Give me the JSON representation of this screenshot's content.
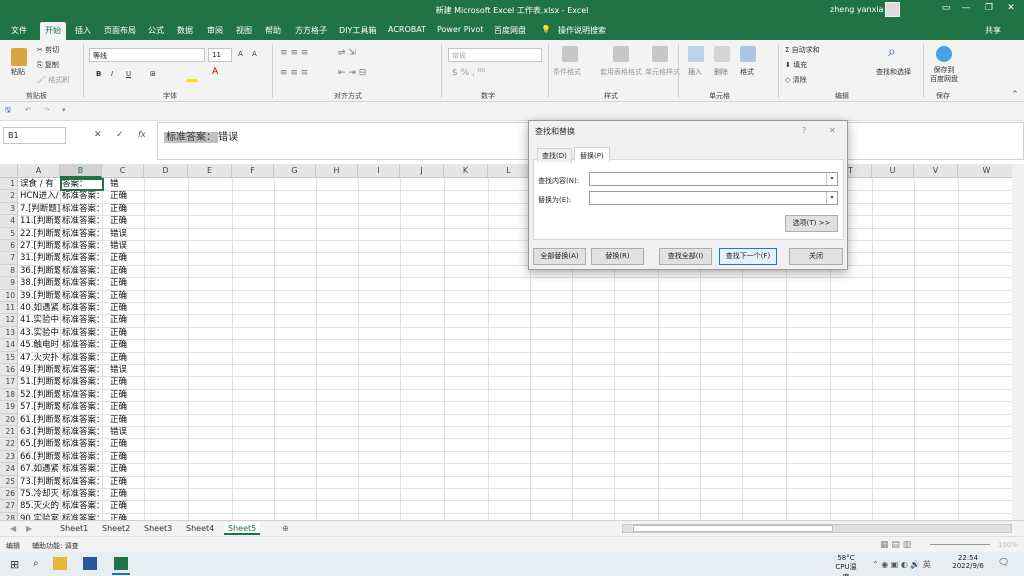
{
  "window": {
    "title": "新建 Microsoft Excel 工作表.xlsx  -  Excel",
    "user": "zheng yanxia",
    "controls": [
      "?",
      "—",
      "❐",
      "✕"
    ]
  },
  "ribbon_tabs": [
    "文件",
    "开始",
    "插入",
    "页面布局",
    "公式",
    "数据",
    "审阅",
    "视图",
    "帮助",
    "方方格子",
    "DIY工具箱",
    "ACROBAT",
    "Power Pivot",
    "百度网盘",
    "操作说明搜索"
  ],
  "share": "共享",
  "ribbon": {
    "clipboard": {
      "paste": "粘贴",
      "cut": "剪切",
      "copy": "复制",
      "format_painter": "格式刷",
      "label": "剪贴板"
    },
    "font": {
      "name": "等线",
      "size": "11",
      "bold": "B",
      "italic": "I",
      "underline": "U",
      "label": "字体"
    },
    "align": {
      "label": "对齐方式"
    },
    "number": {
      "format": "常规",
      "label": "数字"
    },
    "styles": {
      "conditional": "条件格式",
      "table": "套用表格格式",
      "cell_styles": "单元格样式",
      "label": "样式"
    },
    "cells": {
      "insert": "插入",
      "delete": "删除",
      "format": "格式",
      "label": "单元格"
    },
    "editing": {
      "autosum": "自动求和",
      "fill": "填充",
      "clear": "清除",
      "find": "查找和选择",
      "label": "编辑"
    },
    "save": {
      "btn": "保存到\n百度网盘",
      "label": "保存"
    }
  },
  "name_box": "B1",
  "fx": "fx",
  "formula": {
    "selected": "标准答案：",
    "rest": "错误"
  },
  "columns": [
    "A",
    "B",
    "C",
    "D",
    "E",
    "F",
    "G",
    "H",
    "I",
    "J",
    "K",
    "L",
    "M",
    "N",
    "O",
    "P",
    "Q",
    "R",
    "S",
    "T",
    "U",
    "V",
    "W"
  ],
  "rows": [
    {
      "n": "1",
      "a": "误食 / 有",
      "b": "答案：",
      "c": "错"
    },
    {
      "n": "2",
      "a": "HCN进入/",
      "b": "标准答案：",
      "c": "正确"
    },
    {
      "n": "3",
      "a": "7.[判断题]",
      "b": "标准答案：",
      "c": "正确"
    },
    {
      "n": "4",
      "a": "11.[判断题]",
      "b": "标准答案：",
      "c": "正确"
    },
    {
      "n": "5",
      "a": "22.[判断题]",
      "b": "标准答案：",
      "c": "错误"
    },
    {
      "n": "6",
      "a": "27.[判断题]",
      "b": "标准答案：",
      "c": "错误"
    },
    {
      "n": "7",
      "a": "31.[判断题]",
      "b": "标准答案：",
      "c": "正确"
    },
    {
      "n": "8",
      "a": "36.[判断题]",
      "b": "标准答案：",
      "c": "正确"
    },
    {
      "n": "9",
      "a": "38.[判断题]",
      "b": "标准答案：",
      "c": "正确"
    },
    {
      "n": "10",
      "a": "39.[判断题]",
      "b": "标准答案：",
      "c": "正确"
    },
    {
      "n": "11",
      "a": "40.如遇紧",
      "b": "标准答案：",
      "c": "正确"
    },
    {
      "n": "12",
      "a": "41.实验中",
      "b": "标准答案：",
      "c": "正确"
    },
    {
      "n": "13",
      "a": "43.实验中",
      "b": "标准答案：",
      "c": "正确"
    },
    {
      "n": "14",
      "a": "45.触电时",
      "b": "标准答案：",
      "c": "正确"
    },
    {
      "n": "15",
      "a": "47.火灾扑",
      "b": "标准答案：",
      "c": "正确"
    },
    {
      "n": "16",
      "a": "49.[判断题]",
      "b": "标准答案：",
      "c": "错误"
    },
    {
      "n": "17",
      "a": "51.[判断题]",
      "b": "标准答案：",
      "c": "正确"
    },
    {
      "n": "18",
      "a": "52.[判断题]",
      "b": "标准答案：",
      "c": "正确"
    },
    {
      "n": "19",
      "a": "57.[判断题]",
      "b": "标准答案：",
      "c": "正确"
    },
    {
      "n": "20",
      "a": "61.[判断题]",
      "b": "标准答案：",
      "c": "正确"
    },
    {
      "n": "21",
      "a": "63.[判断题]",
      "b": "标准答案：",
      "c": "错误"
    },
    {
      "n": "22",
      "a": "65.[判断题]",
      "b": "标准答案：",
      "c": "正确"
    },
    {
      "n": "23",
      "a": "66.[判断题]",
      "b": "标准答案：",
      "c": "正确"
    },
    {
      "n": "24",
      "a": "67.如遇紧",
      "b": "标准答案：",
      "c": "正确"
    },
    {
      "n": "25",
      "a": "73.[判断题]",
      "b": "标准答案：",
      "c": "正确"
    },
    {
      "n": "26",
      "a": "75.冷却灭",
      "b": "标准答案：",
      "c": "正确"
    },
    {
      "n": "27",
      "a": "85.灭火的",
      "b": "标准答案：",
      "c": "正确"
    },
    {
      "n": "28",
      "a": "90.实验室",
      "b": "标准答案：",
      "c": "正确"
    }
  ],
  "sheets": [
    "Sheet1",
    "Sheet2",
    "Sheet3",
    "Sheet4",
    "Sheet5"
  ],
  "active_sheet": "Sheet5",
  "status": {
    "mode": "编辑",
    "accessibility": "辅助功能: 调查",
    "zoom": "100%"
  },
  "dialog": {
    "title": "查找和替换",
    "tab_find": "查找(D)",
    "tab_replace": "替换(P)",
    "find_label": "查找内容(N):",
    "replace_label": "替换为(E):",
    "options": "选项(T) >>",
    "replace_all": "全部替换(A)",
    "replace": "替换(R)",
    "find_all": "查找全部(I)",
    "find_next": "查找下一个(F)",
    "close": "关闭",
    "help": "?",
    "x": "✕"
  },
  "taskbar": {
    "temp": "58°C",
    "cpu": "CPU温度",
    "time": "22:54",
    "date": "2022/9/6"
  }
}
